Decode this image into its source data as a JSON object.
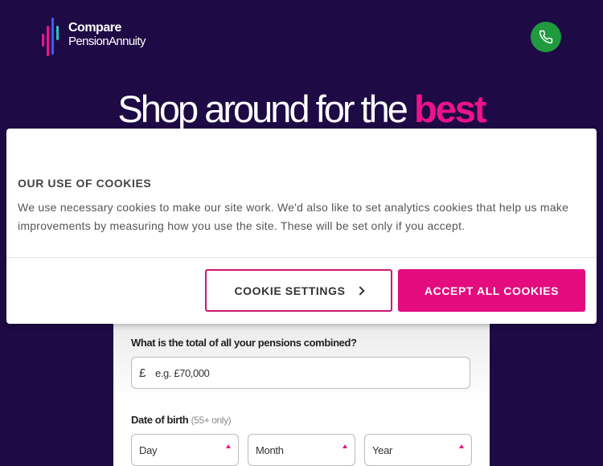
{
  "header": {
    "logo_line1": "Compare",
    "logo_line2": "PensionAnnuity",
    "phone_icon": "phone-icon"
  },
  "hero": {
    "title_prefix": "Shop around for the ",
    "title_accent": "best"
  },
  "form": {
    "pension_question": "What is the total of all your pensions combined?",
    "currency_symbol": "£",
    "pension_placeholder": "e.g. £70,000",
    "dob_label": "Date of birth",
    "dob_hint": "(55+ only)",
    "day_label": "Day",
    "month_label": "Month",
    "year_label": "Year"
  },
  "cookie_banner": {
    "title": "OUR USE OF COOKIES",
    "body": "We use necessary cookies to make our site work. We'd also like to set analytics cookies that help us make improvements by measuring how you use the site. These will be set only if you accept.",
    "settings_label": "COOKIE SETTINGS",
    "accept_label": "ACCEPT ALL COOKIES"
  },
  "colors": {
    "background": "#1e0a45",
    "accent": "#ec1389",
    "phone_button": "#1f9a3e"
  }
}
